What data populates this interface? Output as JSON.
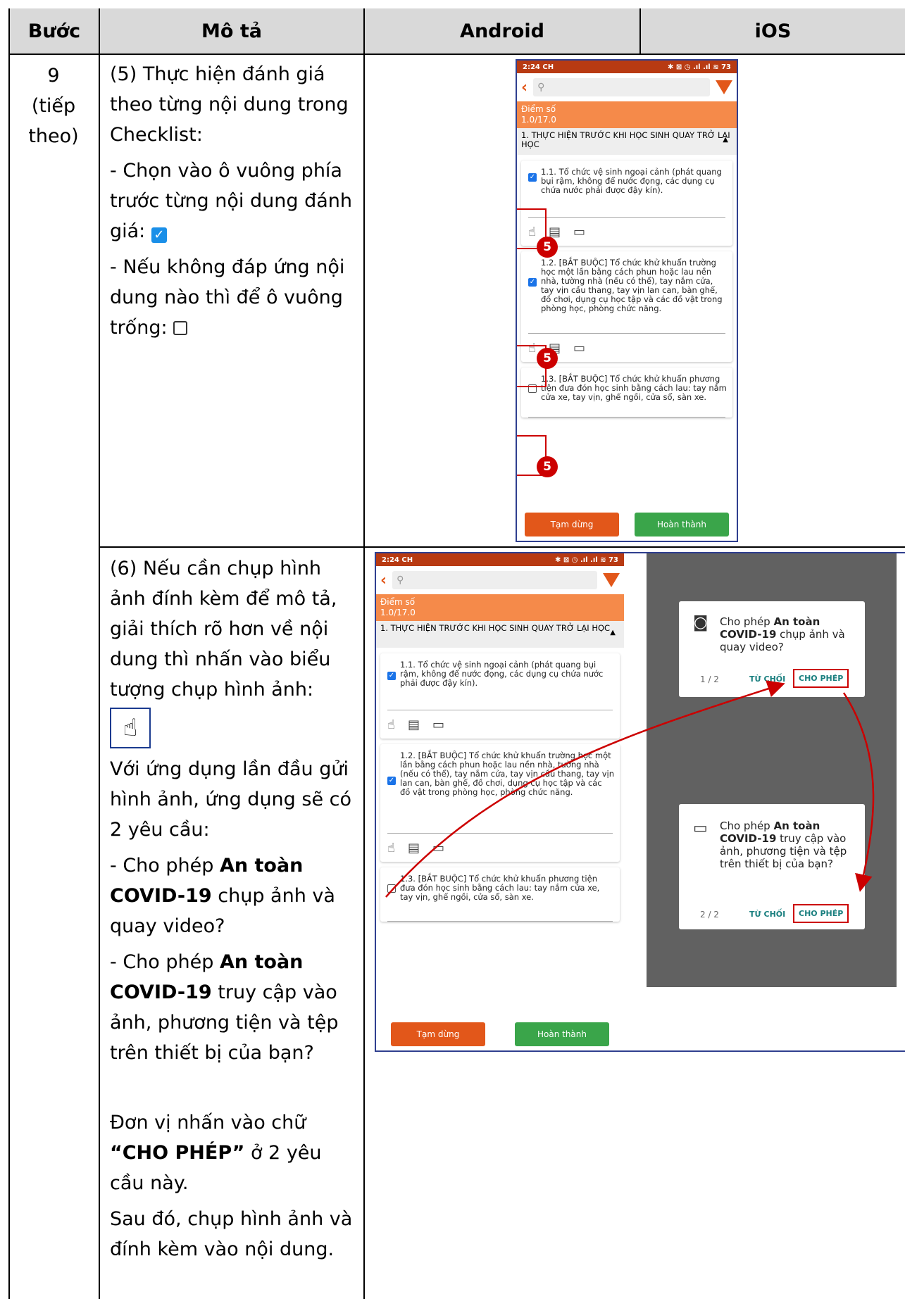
{
  "table": {
    "headers": [
      "Bước",
      "Mô tả",
      "Android",
      "iOS"
    ],
    "step": "9\n(tiếp\ntheo)"
  },
  "row1": {
    "p1": "(5) Thực hiện đánh giá theo từng nội dung trong Checklist:",
    "p2": "- Chọn vào ô vuông phía trước từng nội dung đánh giá:",
    "p2_icon": "checked-checkbox-icon",
    "p3": "- Nếu không đáp ứng nội dung nào thì để ô vuông trống:",
    "p3_icon": "empty-checkbox-icon"
  },
  "row2": {
    "p1": "(6) Nếu cần chụp hình ảnh đính kèm để mô tả, giải thích rõ hơn về nội dung thì nhấn vào biểu tượng chụp hình ảnh:",
    "p1_icon": "camera-attach-icon",
    "p2": "Với ứng dụng lần đầu gửi hình ảnh, ứng dụng sẽ có 2 yêu cầu:",
    "p3_pre": "- Cho phép ",
    "p3_bold": "An toàn COVID-19",
    "p3_post": " chụp ảnh và quay video?",
    "p4_pre": "- Cho phép ",
    "p4_bold": "An toàn COVID-19",
    "p4_post": " truy cập vào ảnh, phương tiện và tệp trên thiết bị của bạn?",
    "p5_pre": "Đơn vị nhấn vào chữ ",
    "p5_bold": "“CHO PHÉP”",
    "p5_post": " ở 2 yêu cầu này.",
    "p6": "Sau đó, chụp hình ảnh và đính kèm vào nội dung."
  },
  "phone": {
    "time": "2:24 CH",
    "status_icons": "✱ ⊠ ◷ .ıl .ıl ≋ 73",
    "search_icon": "search-icon",
    "score_label": "Điểm số",
    "score_value": "1.0/17.0",
    "section": "1. THỰC HIỆN TRƯỚC KHI HỌC SINH QUAY TRỞ LẠI HỌC",
    "item1": "1.1. Tổ chức vệ sinh ngoại cảnh (phát quang bụi rậm, không để nước đọng, các dụng cụ chứa nước phải được đậy kín).",
    "item2": "1.2. [BẮT BUỘC] Tổ chức khử khuẩn trường học một lần bằng cách phun hoặc lau nền nhà, tường nhà (nếu có thể), tay nắm cửa, tay vịn cầu thang, tay vịn lan can, bàn ghế, đồ chơi, dụng cụ học tập và các đồ vật trong phòng học, phòng chức năng.",
    "item3": "1.3. [BẮT BUỘC] Tổ chức khử khuẩn phương tiện đưa đón học sinh bằng cách lau: tay nắm cửa xe, tay vịn, ghế ngồi, cửa sổ, sàn xe.",
    "pause": "Tạm dừng",
    "done": "Hoàn thành",
    "badge": "5",
    "color_pause": "#e2571a",
    "color_done": "#3aa54a"
  },
  "dialogs": {
    "d1_pre": "Cho phép ",
    "d1_bold": "An toàn COVID-19",
    "d1_post": " chụp ảnh và quay video?",
    "d1_count": "1 / 2",
    "d2_pre": "Cho phép ",
    "d2_bold": "An toàn COVID-19",
    "d2_post": " truy cập vào ảnh, phương tiện và tệp trên thiết bị của bạn?",
    "d2_count": "2 / 2",
    "deny": "TỪ CHỐI",
    "allow": "CHO PHÉP"
  }
}
